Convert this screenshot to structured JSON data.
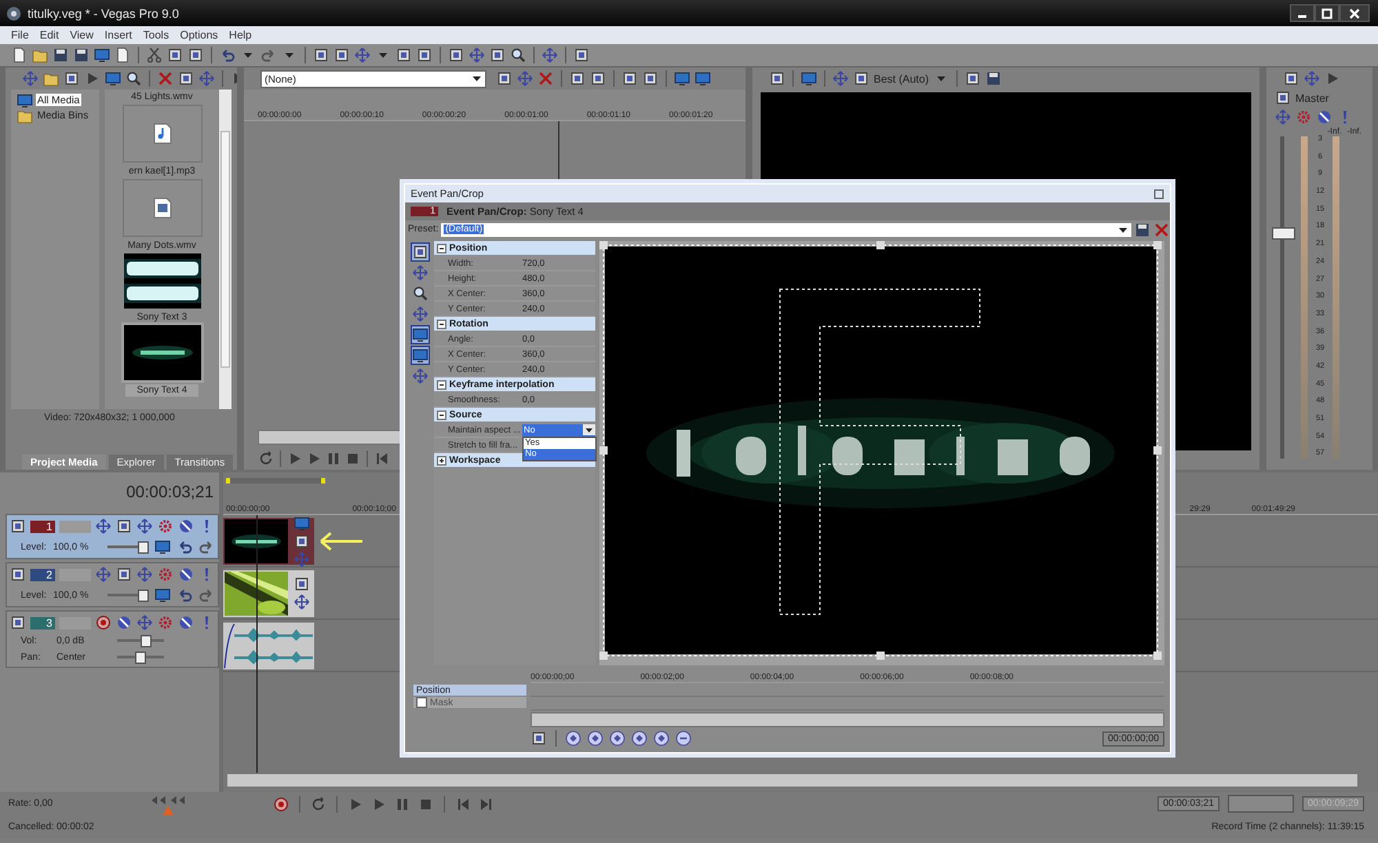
{
  "window": {
    "title": "titulky.veg * - Vegas Pro 9.0"
  },
  "menu": [
    "File",
    "Edit",
    "View",
    "Insert",
    "Tools",
    "Options",
    "Help"
  ],
  "media_panel": {
    "tree": [
      {
        "label": "All Media",
        "selected": true
      },
      {
        "label": "Media Bins",
        "selected": false
      }
    ],
    "items": [
      {
        "label": "45 Lights.wmv",
        "kind": "caption",
        "selected": false
      },
      {
        "label": "ern kael[1].mp3",
        "kind": "audio",
        "selected": false
      },
      {
        "label": "Many Dots.wmv",
        "kind": "video",
        "selected": false
      },
      {
        "label": "Sony Text 3",
        "kind": "picture",
        "selected": false
      },
      {
        "label": "Sony Text 4",
        "kind": "picture",
        "selected": true
      }
    ],
    "info": "Video: 720x480x32; 1 000,000",
    "tabs": [
      {
        "label": "Project Media",
        "selected": true
      },
      {
        "label": "Explorer",
        "selected": false
      },
      {
        "label": "Transitions",
        "selected": false
      }
    ]
  },
  "trimmer": {
    "dropdown": "(None)",
    "ruler": [
      "00:00:00:00",
      "00:00:00:10",
      "00:00:00:20",
      "00:00:01:00",
      "00:00:01:10",
      "00:00:01:20"
    ]
  },
  "preview": {
    "quality": "Best (Auto)"
  },
  "master": {
    "label": "Master",
    "peaks": [
      "-Inf.",
      "-Inf."
    ],
    "scale": [
      "3",
      "6",
      "9",
      "12",
      "15",
      "18",
      "21",
      "24",
      "27",
      "30",
      "33",
      "36",
      "39",
      "42",
      "45",
      "48",
      "51",
      "54",
      "57"
    ],
    "level": 0.72
  },
  "timeline": {
    "time": "00:00:03;21",
    "ruler": [
      "00:00:00;00",
      "00:00:10;00"
    ],
    "ruler_right": [
      "29:29",
      "00:01:49:29"
    ],
    "tracks": [
      {
        "number": "1",
        "kind": "video",
        "color": "#7b1e26",
        "selected": true,
        "params": [
          {
            "label": "Level:",
            "value": "100,0 %",
            "level": 0.88
          }
        ]
      },
      {
        "number": "2",
        "kind": "video",
        "color": "#2e4a80",
        "selected": false,
        "params": [
          {
            "label": "Level:",
            "value": "100,0 %",
            "level": 0.88
          }
        ]
      },
      {
        "number": "3",
        "kind": "audio",
        "color": "#2b6e6c",
        "selected": false,
        "params": [
          {
            "label": "Vol:",
            "value": "0,0 dB",
            "level": 0.62
          },
          {
            "label": "Pan:",
            "value": "Center",
            "level": 0.5
          }
        ]
      }
    ]
  },
  "bottom": {
    "rate": "Rate: 0,00",
    "rate_slider": {
      "level": 0.5
    },
    "status": "Cancelled: 00:00:02",
    "cursor": "00:00:03;21",
    "length": "00:00:09;29",
    "record": "Record Time (2 channels): 11:39:15"
  },
  "dialog": {
    "title": "Event Pan/Crop",
    "badge": "1",
    "header": "**Event Pan/Crop:** Sony Text 4",
    "preset_label": "Preset:",
    "preset": "(Default)",
    "groups": [
      {
        "label": "Position",
        "expanded": true,
        "rows": [
          {
            "label": "Width:",
            "value": "720,0"
          },
          {
            "label": "Height:",
            "value": "480,0"
          },
          {
            "label": "X Center:",
            "value": "360,0"
          },
          {
            "label": "Y Center:",
            "value": "240,0"
          }
        ]
      },
      {
        "label": "Rotation",
        "expanded": true,
        "rows": [
          {
            "label": "Angle:",
            "value": "0,0"
          },
          {
            "label": "X Center:",
            "value": "360,0"
          },
          {
            "label": "Y Center:",
            "value": "240,0"
          }
        ]
      },
      {
        "label": "Keyframe interpolation",
        "expanded": true,
        "rows": [
          {
            "label": "Smoothness:",
            "value": "0,0"
          }
        ]
      },
      {
        "label": "Source",
        "expanded": true,
        "rows": [
          {
            "label": "Maintain aspect ...",
            "value": "No",
            "kind": "dropdown",
            "options": [
              {
                "label": "Yes",
                "selected": false
              },
              {
                "label": "No",
                "selected": true
              }
            ]
          },
          {
            "label": "Stretch to fill fra...",
            "kind": "plain"
          }
        ]
      },
      {
        "label": "Workspace",
        "expanded": false
      }
    ],
    "keyframe_rows": [
      {
        "label": "Position",
        "kind": "track",
        "selected": true
      },
      {
        "label": "Mask",
        "kind": "checkbox",
        "checked": false,
        "disabled": true
      }
    ],
    "ruler": [
      "00:00:00;00",
      "00:00:02;00",
      "00:00:04;00",
      "00:00:06;00",
      "00:00:08;00"
    ],
    "time": "00:00:00;00"
  }
}
